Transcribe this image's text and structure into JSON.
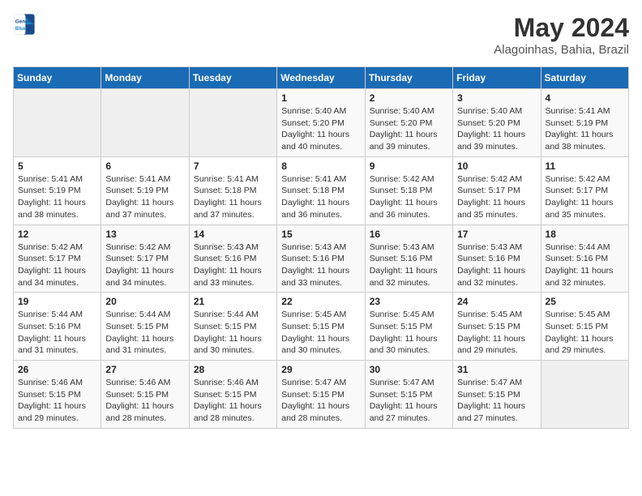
{
  "header": {
    "logo_line1": "General",
    "logo_line2": "Blue",
    "month": "May 2024",
    "location": "Alagoinhas, Bahia, Brazil"
  },
  "days_of_week": [
    "Sunday",
    "Monday",
    "Tuesday",
    "Wednesday",
    "Thursday",
    "Friday",
    "Saturday"
  ],
  "weeks": [
    [
      {
        "day": "",
        "info": ""
      },
      {
        "day": "",
        "info": ""
      },
      {
        "day": "",
        "info": ""
      },
      {
        "day": "1",
        "info": "Sunrise: 5:40 AM\nSunset: 5:20 PM\nDaylight: 11 hours\nand 40 minutes."
      },
      {
        "day": "2",
        "info": "Sunrise: 5:40 AM\nSunset: 5:20 PM\nDaylight: 11 hours\nand 39 minutes."
      },
      {
        "day": "3",
        "info": "Sunrise: 5:40 AM\nSunset: 5:20 PM\nDaylight: 11 hours\nand 39 minutes."
      },
      {
        "day": "4",
        "info": "Sunrise: 5:41 AM\nSunset: 5:19 PM\nDaylight: 11 hours\nand 38 minutes."
      }
    ],
    [
      {
        "day": "5",
        "info": "Sunrise: 5:41 AM\nSunset: 5:19 PM\nDaylight: 11 hours\nand 38 minutes."
      },
      {
        "day": "6",
        "info": "Sunrise: 5:41 AM\nSunset: 5:19 PM\nDaylight: 11 hours\nand 37 minutes."
      },
      {
        "day": "7",
        "info": "Sunrise: 5:41 AM\nSunset: 5:18 PM\nDaylight: 11 hours\nand 37 minutes."
      },
      {
        "day": "8",
        "info": "Sunrise: 5:41 AM\nSunset: 5:18 PM\nDaylight: 11 hours\nand 36 minutes."
      },
      {
        "day": "9",
        "info": "Sunrise: 5:42 AM\nSunset: 5:18 PM\nDaylight: 11 hours\nand 36 minutes."
      },
      {
        "day": "10",
        "info": "Sunrise: 5:42 AM\nSunset: 5:17 PM\nDaylight: 11 hours\nand 35 minutes."
      },
      {
        "day": "11",
        "info": "Sunrise: 5:42 AM\nSunset: 5:17 PM\nDaylight: 11 hours\nand 35 minutes."
      }
    ],
    [
      {
        "day": "12",
        "info": "Sunrise: 5:42 AM\nSunset: 5:17 PM\nDaylight: 11 hours\nand 34 minutes."
      },
      {
        "day": "13",
        "info": "Sunrise: 5:42 AM\nSunset: 5:17 PM\nDaylight: 11 hours\nand 34 minutes."
      },
      {
        "day": "14",
        "info": "Sunrise: 5:43 AM\nSunset: 5:16 PM\nDaylight: 11 hours\nand 33 minutes."
      },
      {
        "day": "15",
        "info": "Sunrise: 5:43 AM\nSunset: 5:16 PM\nDaylight: 11 hours\nand 33 minutes."
      },
      {
        "day": "16",
        "info": "Sunrise: 5:43 AM\nSunset: 5:16 PM\nDaylight: 11 hours\nand 32 minutes."
      },
      {
        "day": "17",
        "info": "Sunrise: 5:43 AM\nSunset: 5:16 PM\nDaylight: 11 hours\nand 32 minutes."
      },
      {
        "day": "18",
        "info": "Sunrise: 5:44 AM\nSunset: 5:16 PM\nDaylight: 11 hours\nand 32 minutes."
      }
    ],
    [
      {
        "day": "19",
        "info": "Sunrise: 5:44 AM\nSunset: 5:16 PM\nDaylight: 11 hours\nand 31 minutes."
      },
      {
        "day": "20",
        "info": "Sunrise: 5:44 AM\nSunset: 5:15 PM\nDaylight: 11 hours\nand 31 minutes."
      },
      {
        "day": "21",
        "info": "Sunrise: 5:44 AM\nSunset: 5:15 PM\nDaylight: 11 hours\nand 30 minutes."
      },
      {
        "day": "22",
        "info": "Sunrise: 5:45 AM\nSunset: 5:15 PM\nDaylight: 11 hours\nand 30 minutes."
      },
      {
        "day": "23",
        "info": "Sunrise: 5:45 AM\nSunset: 5:15 PM\nDaylight: 11 hours\nand 30 minutes."
      },
      {
        "day": "24",
        "info": "Sunrise: 5:45 AM\nSunset: 5:15 PM\nDaylight: 11 hours\nand 29 minutes."
      },
      {
        "day": "25",
        "info": "Sunrise: 5:45 AM\nSunset: 5:15 PM\nDaylight: 11 hours\nand 29 minutes."
      }
    ],
    [
      {
        "day": "26",
        "info": "Sunrise: 5:46 AM\nSunset: 5:15 PM\nDaylight: 11 hours\nand 29 minutes."
      },
      {
        "day": "27",
        "info": "Sunrise: 5:46 AM\nSunset: 5:15 PM\nDaylight: 11 hours\nand 28 minutes."
      },
      {
        "day": "28",
        "info": "Sunrise: 5:46 AM\nSunset: 5:15 PM\nDaylight: 11 hours\nand 28 minutes."
      },
      {
        "day": "29",
        "info": "Sunrise: 5:47 AM\nSunset: 5:15 PM\nDaylight: 11 hours\nand 28 minutes."
      },
      {
        "day": "30",
        "info": "Sunrise: 5:47 AM\nSunset: 5:15 PM\nDaylight: 11 hours\nand 27 minutes."
      },
      {
        "day": "31",
        "info": "Sunrise: 5:47 AM\nSunset: 5:15 PM\nDaylight: 11 hours\nand 27 minutes."
      },
      {
        "day": "",
        "info": ""
      }
    ]
  ]
}
